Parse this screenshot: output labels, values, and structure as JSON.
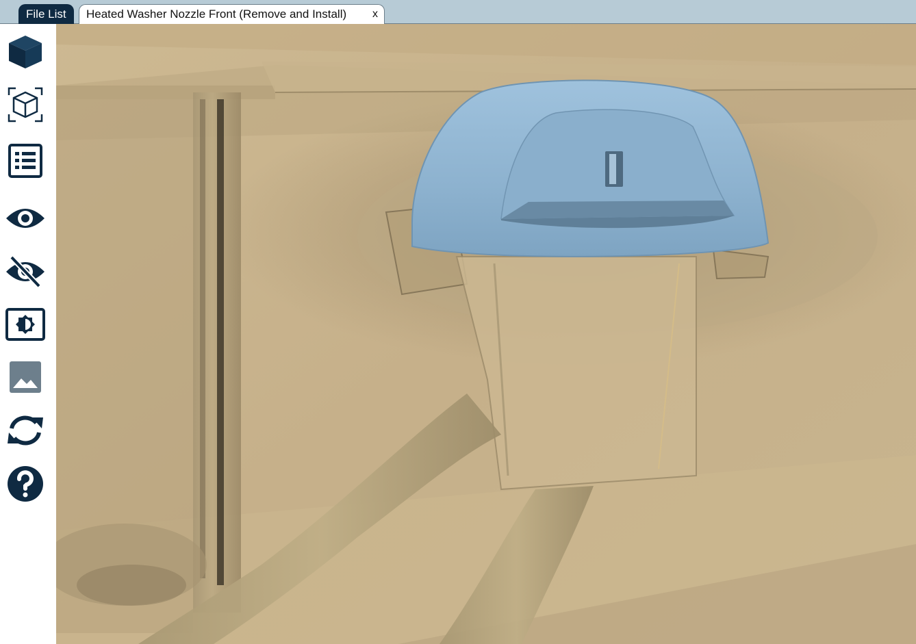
{
  "tabs": {
    "file_list": "File List",
    "document": "Heated Washer Nozzle Front (Remove and Install)",
    "close": "x"
  },
  "toolbar": {
    "icons": [
      "solid-cube-icon",
      "wireframe-cube-icon",
      "parts-list-icon",
      "eye-icon",
      "eye-slash-icon",
      "contrast-icon",
      "image-icon",
      "refresh-icon",
      "help-icon"
    ]
  },
  "colors": {
    "tabbar": "#b7cbd6",
    "icon": "#0f2a42",
    "icon_muted": "#6d7f8c",
    "nozzle": "#8fb4d0",
    "body": "#c9b48c"
  }
}
